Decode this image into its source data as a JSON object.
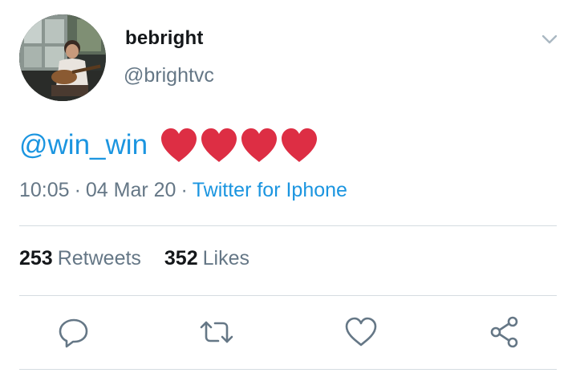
{
  "author": {
    "display_name": "bebright",
    "handle": "@brightvc"
  },
  "tweet": {
    "mention": "@win_win",
    "emoji": "❤️❤️❤️❤️"
  },
  "meta": {
    "time": "10:05",
    "date": "04 Mar 20",
    "separator": "·",
    "source": "Twitter for Iphone"
  },
  "stats": {
    "retweets_count": "253",
    "retweets_label": "Retweets",
    "likes_count": "352",
    "likes_label": "Likes"
  },
  "actions": [
    "reply-icon",
    "retweet-icon",
    "like-icon",
    "share-icon"
  ],
  "colors": {
    "link_blue": "#1b95e0",
    "secondary_text": "#657786",
    "primary_text": "#14171a",
    "heart_red": "#dd2e44",
    "divider": "#d5dce1"
  }
}
